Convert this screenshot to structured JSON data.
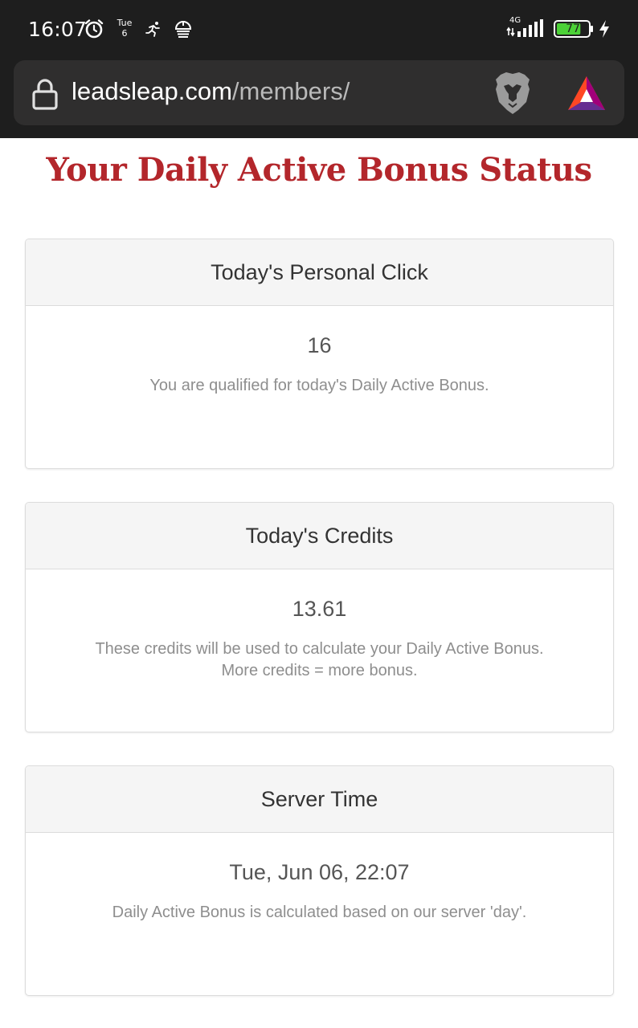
{
  "status_bar": {
    "time": "16:07",
    "day": "Tue",
    "date": "6",
    "network": "4G",
    "battery": "77",
    "battery_level": 0.77,
    "icons": [
      "alarm-icon",
      "runner-icon",
      "satellite-dish-icon",
      "signal-icon",
      "battery-icon",
      "charging-bolt-icon"
    ]
  },
  "browser": {
    "url_domain": "leadsleap.com",
    "url_path": "/members/",
    "icons": [
      "lock-icon",
      "brave-lion-icon",
      "bat-triangle-icon"
    ]
  },
  "page": {
    "title": "Your Daily Active Bonus Status",
    "title_color": "#b3262b"
  },
  "panels": [
    {
      "heading": "Today's Personal Click",
      "value": "16",
      "note_lines": [
        "You are qualified for today's Daily Active Bonus."
      ]
    },
    {
      "heading": "Today's Credits",
      "value": "13.61",
      "note_lines": [
        "These credits will be used to calculate your Daily Active Bonus.",
        "More credits = more bonus."
      ]
    },
    {
      "heading": "Server Time",
      "value": "Tue, Jun 06, 22:07",
      "note_lines": [
        "Daily Active Bonus is calculated based on our server 'day'."
      ]
    }
  ]
}
